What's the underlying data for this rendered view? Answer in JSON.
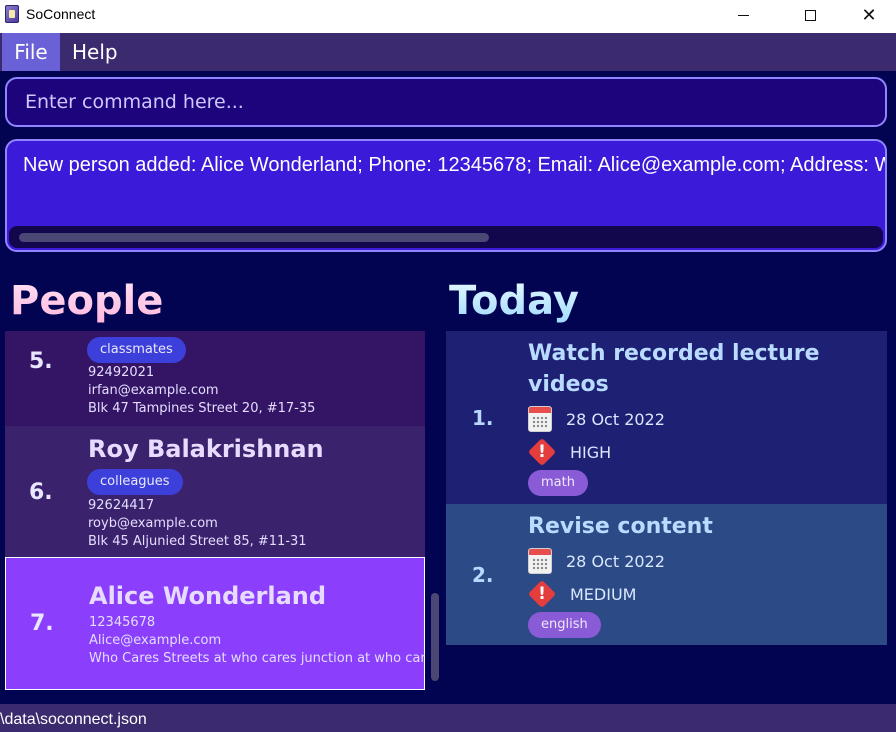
{
  "window": {
    "title": "SoConnect",
    "minimize_icon": "minimize-icon",
    "maximize_icon": "maximize-icon",
    "close_glyph": "✕"
  },
  "menu": {
    "items": [
      {
        "label": "File",
        "active": true
      },
      {
        "label": "Help",
        "active": false
      }
    ]
  },
  "command": {
    "placeholder": "Enter command here..."
  },
  "result": {
    "text": "New person added: Alice Wonderland; Phone: 12345678; Email: Alice@example.com; Address: Who Cares Streets at who cares junction at who cares"
  },
  "people": {
    "heading": "People",
    "cards": [
      {
        "index": "5.",
        "tag": "classmates",
        "phone": "92492021",
        "email": "irfan@example.com",
        "address": "Blk 47 Tampines Street 20, #17-35"
      },
      {
        "index": "6.",
        "name": "Roy Balakrishnan",
        "tag": "colleagues",
        "phone": "92624417",
        "email": "royb@example.com",
        "address": "Blk 45 Aljunied Street 85, #11-31"
      },
      {
        "index": "7.",
        "name": "Alice Wonderland",
        "phone": "12345678",
        "email": "Alice@example.com",
        "address": "Who Cares Streets at who cares junction at who cares",
        "selected": true
      }
    ]
  },
  "today": {
    "heading": "Today",
    "tasks": [
      {
        "index": "1.",
        "title": "Watch recorded lecture videos",
        "date": "28 Oct 2022",
        "priority": "HIGH",
        "tag": "math"
      },
      {
        "index": "2.",
        "title": "Revise content",
        "date": "28 Oct 2022",
        "priority": "MEDIUM",
        "tag": "english"
      }
    ]
  },
  "status": {
    "path": "\\data\\soconnect.json"
  },
  "colors": {
    "background": "#020452",
    "menu_bar": "#3b2a6e",
    "command_box": "#1e047c",
    "result_box": "#3b1ad9",
    "selected_card": "#8b3ffc",
    "priority_high": "#e33d3d"
  }
}
